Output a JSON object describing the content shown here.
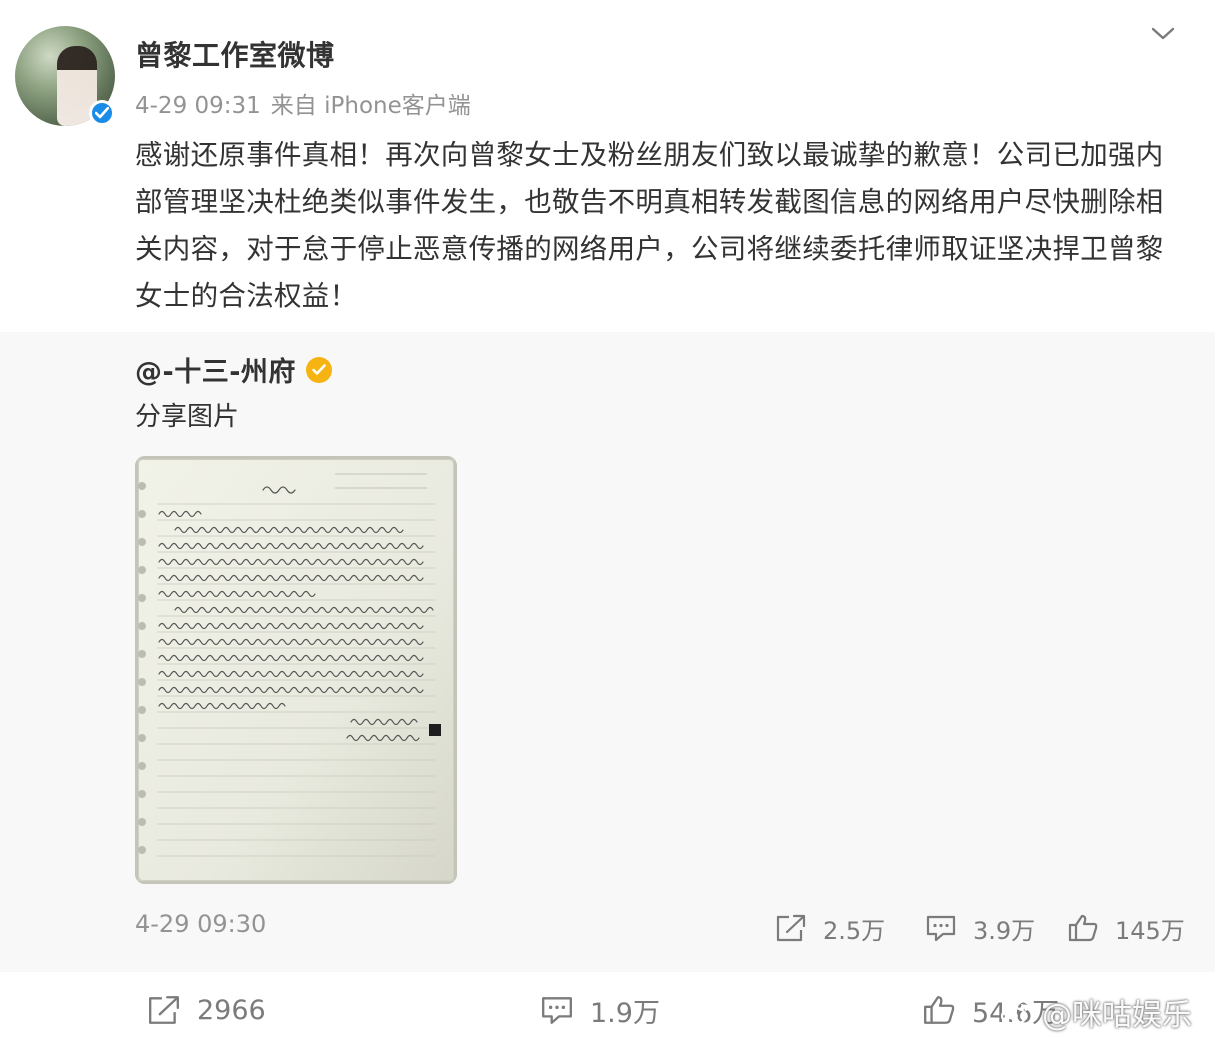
{
  "post": {
    "username": "曾黎工作室微博",
    "time": "4-29 09:31",
    "source": "来自 iPhone客户端",
    "text": "感谢还原事件真相！再次向曾黎女士及粉丝朋友们致以最诚挚的歉意！公司已加强内部管理坚决杜绝类似事件发生，也敬告不明真相转发截图信息的网络用户尽快删除相关内容，对于怠于停止恶意传播的网络用户，公司将继续委托律师取证坚决捍卫曾黎女士的合法权益！",
    "stats": {
      "reposts": "2966",
      "comments": "1.9万",
      "likes": "54.6万"
    }
  },
  "repost": {
    "username": "@-十三-州府",
    "text": "分享图片",
    "time": "4-29 09:30",
    "stats": {
      "reposts": "2.5万",
      "comments": "3.9万",
      "likes": "145万"
    },
    "image_alt": "handwritten apology letter on lined notebook paper"
  },
  "watermark": {
    "text": "@咪咕娱乐"
  },
  "colors": {
    "verified_blue": "#1a8ce8",
    "verified_gold": "#f5b412",
    "meta_gray": "#939393",
    "repost_bg": "#f8f8f8"
  },
  "icons": {
    "menu": "chevron-down-icon",
    "repost": "share-arrow-icon",
    "comment": "comment-bubble-icon",
    "like": "thumbs-up-icon"
  }
}
